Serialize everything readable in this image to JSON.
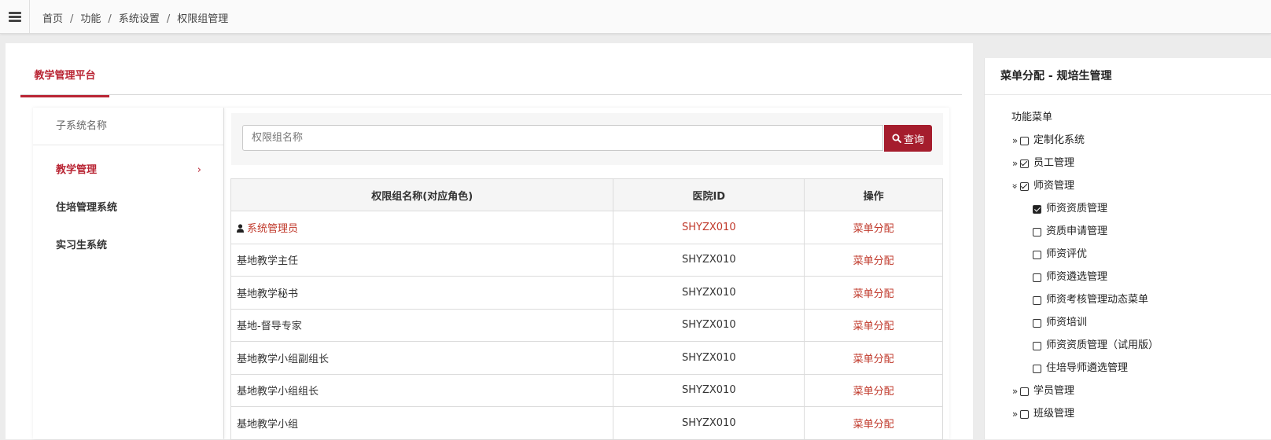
{
  "breadcrumb": {
    "items": [
      "首页",
      "功能",
      "系统设置",
      "权限组管理"
    ],
    "separator": "/"
  },
  "platform_tab": "教学管理平台",
  "subsystem": {
    "header": "子系统名称",
    "items": [
      {
        "label": "教学管理",
        "active": true,
        "chevron": "›"
      },
      {
        "label": "住培管理系统",
        "active": false
      },
      {
        "label": "实习生系统",
        "active": false
      }
    ]
  },
  "search": {
    "placeholder": "权限组名称",
    "value": "",
    "button_label": "查询"
  },
  "table": {
    "headers": [
      "权限组名称(对应角色)",
      "医院ID",
      "操作"
    ],
    "rows": [
      {
        "name": "系统管理员",
        "hospital_id": "SHYZX010",
        "action": "菜单分配",
        "admin": true
      },
      {
        "name": "基地教学主任",
        "hospital_id": "SHYZX010",
        "action": "菜单分配"
      },
      {
        "name": "基地教学秘书",
        "hospital_id": "SHYZX010",
        "action": "菜单分配"
      },
      {
        "name": "基地-督导专家",
        "hospital_id": "SHYZX010",
        "action": "菜单分配"
      },
      {
        "name": "基地教学小组副组长",
        "hospital_id": "SHYZX010",
        "action": "菜单分配"
      },
      {
        "name": "基地教学小组组长",
        "hospital_id": "SHYZX010",
        "action": "菜单分配"
      },
      {
        "name": "基地教学小组",
        "hospital_id": "SHYZX010",
        "action": "菜单分配"
      }
    ]
  },
  "right_panel": {
    "title": "菜单分配 - 规培生管理",
    "root_label": "功能菜单",
    "nodes": [
      {
        "label": "定制化系统",
        "expander": "»",
        "state": "unchecked",
        "level": 0
      },
      {
        "label": "员工管理",
        "expander": "»",
        "state": "checked",
        "level": 0
      },
      {
        "label": "师资管理",
        "expander": "»",
        "state": "checked",
        "level": 0,
        "expanded": true
      },
      {
        "label": "师资资质管理",
        "state": "filled",
        "level": 1
      },
      {
        "label": "资质申请管理",
        "state": "unchecked",
        "level": 1
      },
      {
        "label": "师资评优",
        "state": "unchecked",
        "level": 1
      },
      {
        "label": "师资遴选管理",
        "state": "unchecked",
        "level": 1
      },
      {
        "label": "师资考核管理动态菜单",
        "state": "unchecked",
        "level": 1
      },
      {
        "label": "师资培训",
        "state": "unchecked",
        "level": 1
      },
      {
        "label": "师资资质管理（试用版）",
        "state": "unchecked",
        "level": 1
      },
      {
        "label": "住培导师遴选管理",
        "state": "unchecked",
        "level": 1
      },
      {
        "label": "学员管理",
        "expander": "»",
        "state": "unchecked",
        "level": 0
      },
      {
        "label": "班级管理",
        "expander": "»",
        "state": "unchecked",
        "level": 0
      }
    ]
  },
  "colors": {
    "accent": "#b92534",
    "button": "#a51d2d",
    "link": "#c0392b"
  }
}
